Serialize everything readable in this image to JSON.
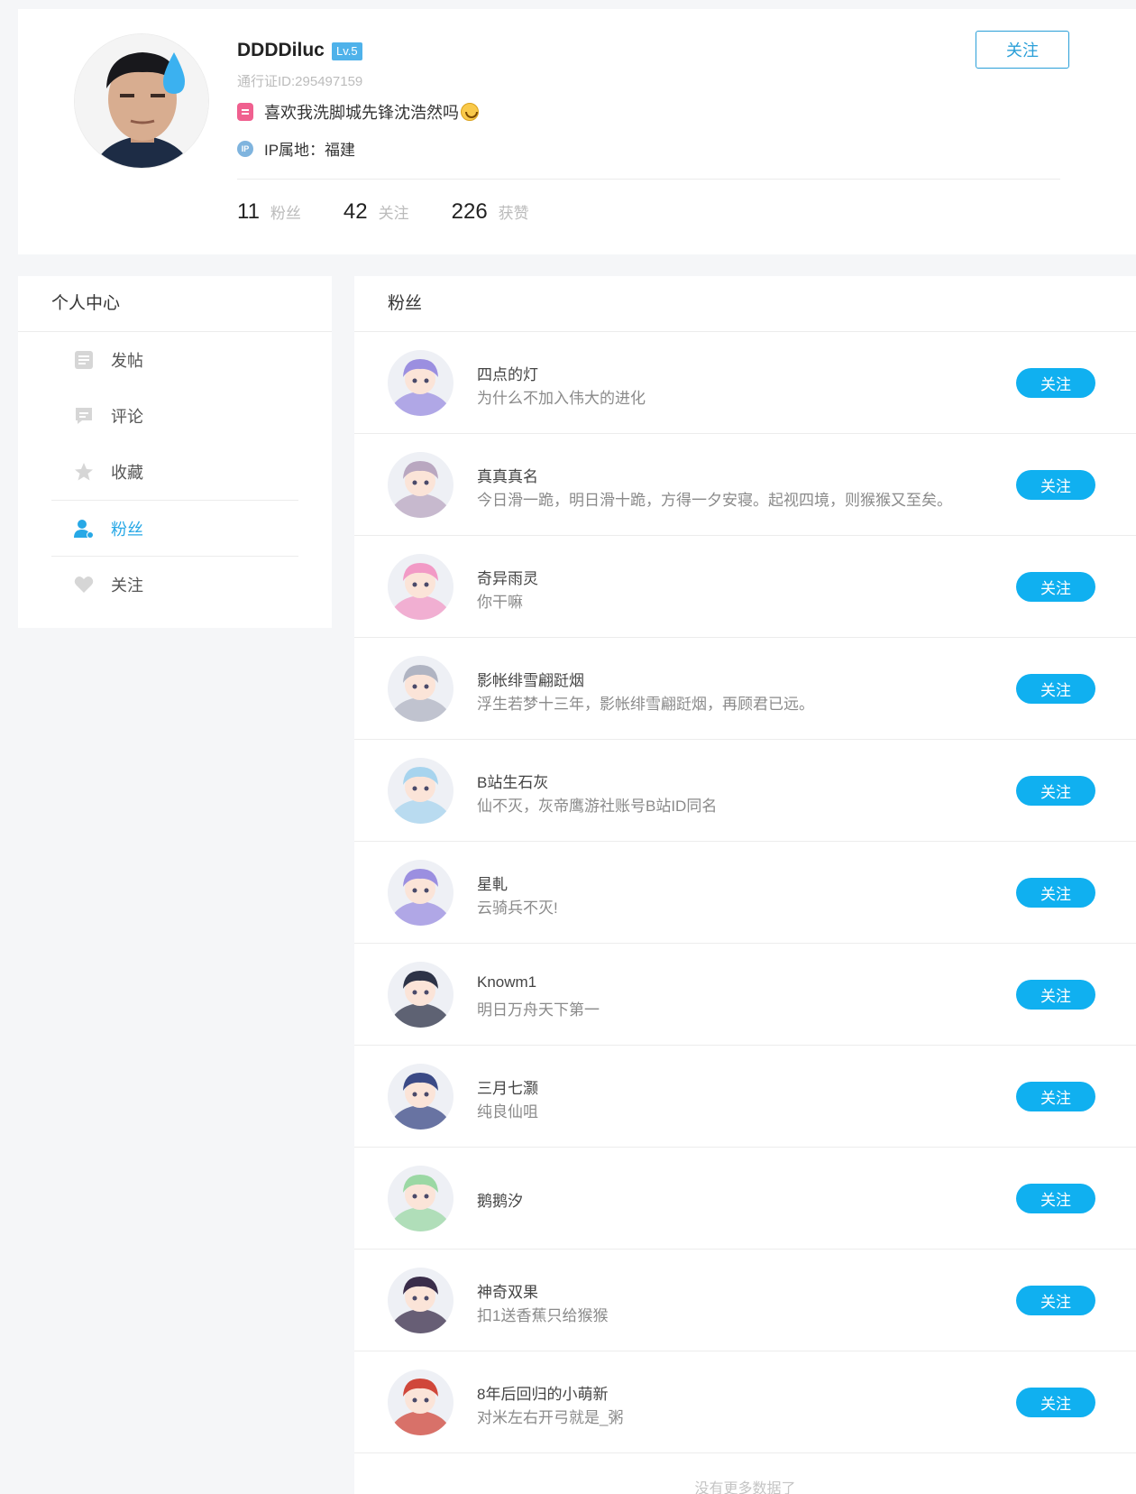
{
  "profile": {
    "username": "DDDDiluc",
    "level": "Lv.5",
    "pass_id": "通行证ID:295497159",
    "signature": "喜欢我洗脚城先锋沈浩然吗",
    "ip_icon_text": "IP",
    "ip_location": "IP属地：福建",
    "follow_label": "关注",
    "stats": [
      {
        "num": "11",
        "label": "粉丝"
      },
      {
        "num": "42",
        "label": "关注"
      },
      {
        "num": "226",
        "label": "获赞"
      }
    ]
  },
  "sidebar": {
    "title": "个人中心",
    "items": [
      {
        "label": "发帖",
        "icon": "post-icon"
      },
      {
        "label": "评论",
        "icon": "comment-icon"
      },
      {
        "label": "收藏",
        "icon": "star-icon"
      },
      {
        "label": "粉丝",
        "icon": "fans-icon",
        "active": true
      },
      {
        "label": "关注",
        "icon": "heart-icon"
      }
    ]
  },
  "main": {
    "title": "粉丝",
    "follow_label": "关注",
    "fans": [
      {
        "name": "四点的灯",
        "sign": "为什么不加入伟大的进化",
        "color": "#9b8fe0"
      },
      {
        "name": "真真真名",
        "sign": "今日滑一跪，明日滑十跪，方得一夕安寝。起视四境，则猴猴又至矣。",
        "color": "#b9a7c0"
      },
      {
        "name": "奇异雨灵",
        "sign": "你干嘛",
        "color": "#f29ac6"
      },
      {
        "name": "影帐绯雪翩跹烟",
        "sign": "浮生若梦十三年，影帐绯雪翩跹烟，再顾君已远。",
        "color": "#b0b4c2"
      },
      {
        "name": "B站生石灰",
        "sign": "仙不灭，灰帝鹰游社账号B站ID同名",
        "color": "#a7d4ee"
      },
      {
        "name": "星軋",
        "sign": "云骑兵不灭!",
        "color": "#9b8fe0"
      },
      {
        "name": "Knowm1",
        "sign": "明日万舟天下第一",
        "color": "#2d3347"
      },
      {
        "name": "三月七灏",
        "sign": "纯良仙咀",
        "color": "#3b4a86"
      },
      {
        "name": "鹅鹅汐",
        "sign": "",
        "color": "#9bd8a4"
      },
      {
        "name": "神奇双果",
        "sign": "扣1送香蕉只给猴猴",
        "color": "#3a2d4a"
      },
      {
        "name": "8年后回归的小萌新",
        "sign": "对米左右开弓就是_粥",
        "color": "#d0473a"
      }
    ],
    "footer": "没有更多数据了"
  }
}
